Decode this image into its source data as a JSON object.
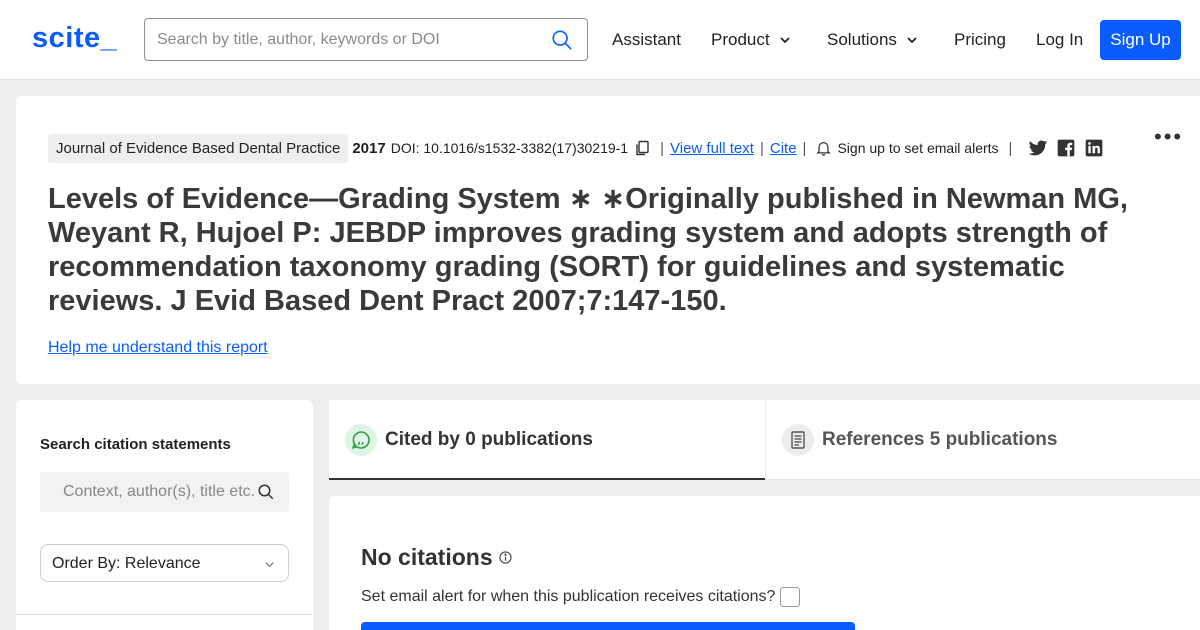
{
  "header": {
    "logo": "scite_",
    "search_placeholder": "Search by title, author, keywords or DOI",
    "nav": {
      "assistant": "Assistant",
      "product": "Product",
      "solutions": "Solutions",
      "pricing": "Pricing",
      "login": "Log In",
      "signup": "Sign Up"
    }
  },
  "article": {
    "journal": "Journal of Evidence Based Dental Practice",
    "year": "2017",
    "doi": "DOI: 10.1016/s1532-3382(17)30219-1",
    "view_full_text": "View full text",
    "cite": "Cite",
    "email_alerts": "Sign up to set email alerts",
    "title": "Levels of Evidence—Grading System ∗ ∗Originally published in Newman MG, Weyant R, Hujoel P: JEBDP improves grading system and adopts strength of recommendation taxonomy grading (SORT) for guidelines and systematic reviews. J Evid Based Dent Pract 2007;7:147-150.",
    "help_link": "Help me understand this report"
  },
  "sidebar": {
    "heading": "Search citation statements",
    "search_placeholder": "Context, author(s), title etc.",
    "order_by": "Order By: Relevance"
  },
  "tabs": {
    "cited_by": "Cited by 0 publications",
    "references": "References 5 publications"
  },
  "content": {
    "no_citations": "No citations",
    "alert_question": "Set email alert for when this publication receives citations?"
  },
  "colors": {
    "brand": "#0a5cff",
    "cited_icon_bg": "#dff5e4",
    "cited_icon_fg": "#2e9e47"
  }
}
